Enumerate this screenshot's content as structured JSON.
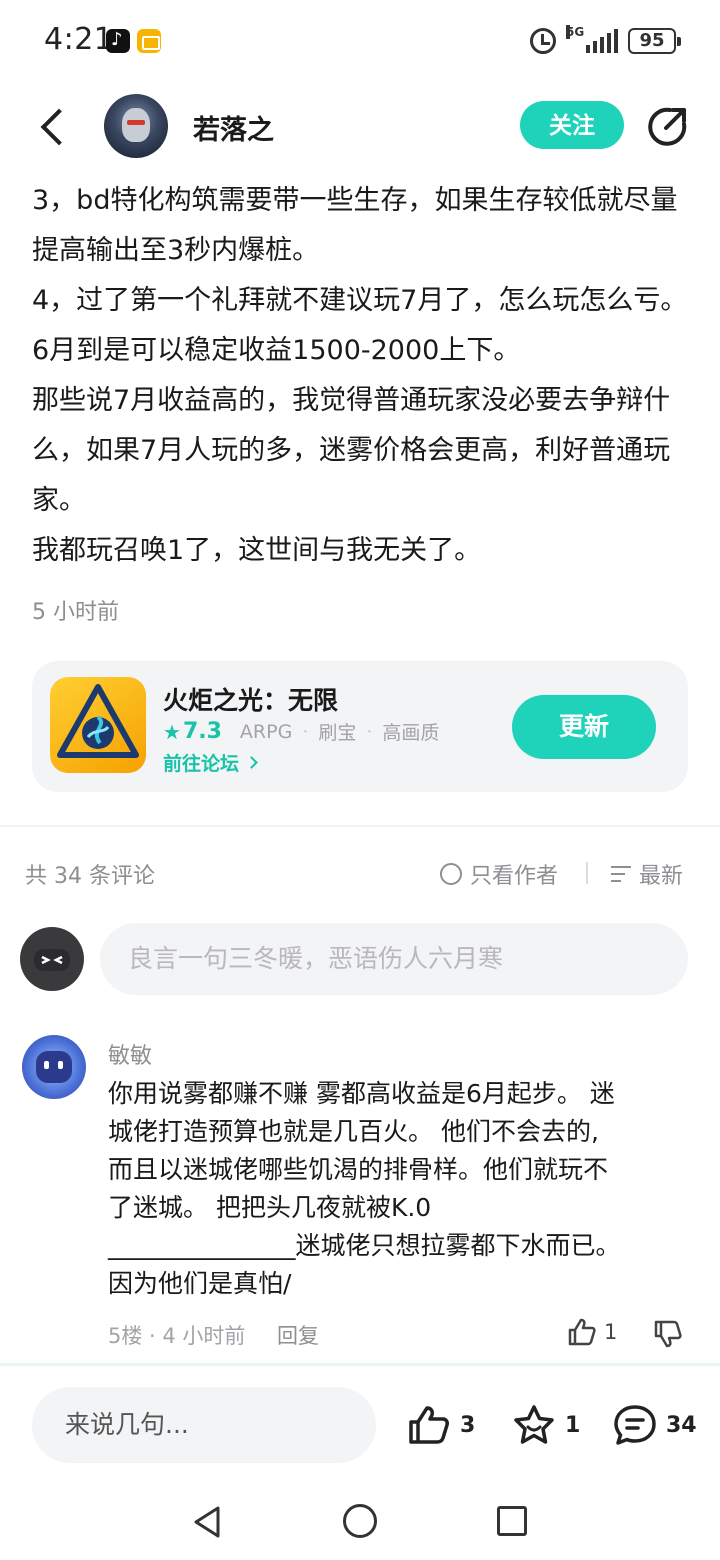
{
  "status_bar": {
    "time": "4:21",
    "network": "5G",
    "battery": "95"
  },
  "header": {
    "author_name": "若落之",
    "follow_label": "关注"
  },
  "post": {
    "paragraphs": [
      "3，bd特化构筑需要带一些生存，如果生存较低就尽量提高输出至3秒内爆桩。",
      "4，过了第一个礼拜就不建议玩7月了，怎么玩怎么亏。6月到是可以稳定收益1500-2000上下。",
      "那些说7月收益高的，我觉得普通玩家没必要去争辩什么，如果7月人玩的多，迷雾价格会更高，利好普通玩家。",
      "我都玩召唤1了，这世间与我无关了。"
    ],
    "time": "5 小时前"
  },
  "game_card": {
    "name": "火炬之光：无限",
    "rating": "7.3",
    "tags": [
      "ARPG",
      "刷宝",
      "高画质"
    ],
    "forum_link": "前往论坛",
    "update_label": "更新"
  },
  "comments": {
    "count_label": "共 34 条评论",
    "author_only_label": "只看作者",
    "sort_label": "最新",
    "input_placeholder": "良言一句三冬暖，恶语伤人六月寒",
    "items": [
      {
        "user": "敏敏",
        "lines": [
          "你用说雾都赚不赚  雾都高收益是6月起步。 迷",
          "城佬打造预算也就是几百火。 他们不会去的,",
          "而且以迷城佬哪些饥渴的排骨样。他们就玩不",
          "了迷城。 把把头几夜就被K.0",
          "_______________迷城佬只想拉雾都下水而已。",
          "因为他们是真怕/"
        ],
        "meta": "5楼 · 4 小时前",
        "reply_label": "回复",
        "likes": "1"
      }
    ]
  },
  "bottom_bar": {
    "input_placeholder": "来说几句...",
    "likes": "3",
    "favorites": "1",
    "comments": "34"
  }
}
